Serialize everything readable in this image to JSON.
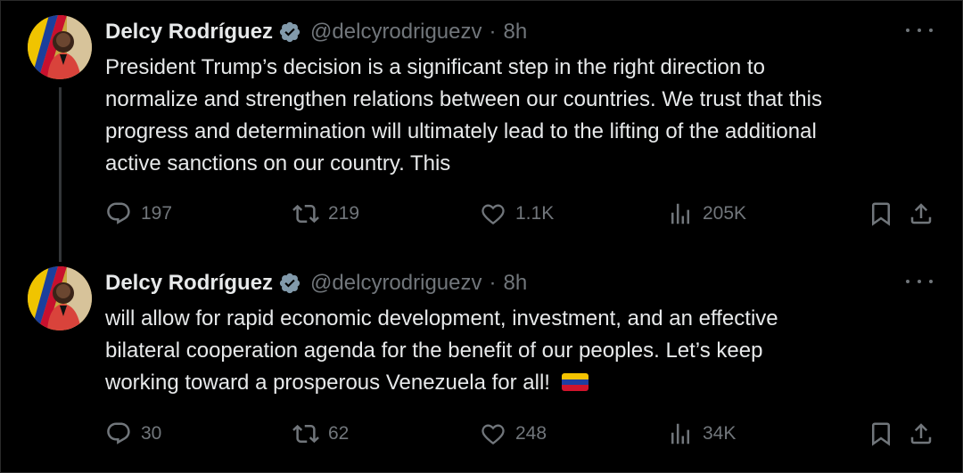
{
  "tweets": [
    {
      "name": "Delcy Rodríguez",
      "handle": "@delcyrodriguezv",
      "separator": "·",
      "time": "8h",
      "text": "President Trump’s decision is a significant step in the right direction to\nnormalize and strengthen relations between our countries. We trust that this\nprogress and determination will ultimately lead to the lifting of the additional\nactive sanctions on our country. This",
      "replies": "197",
      "reposts": "219",
      "likes": "1.1K",
      "views": "205K"
    },
    {
      "name": "Delcy Rodríguez",
      "handle": "@delcyrodriguezv",
      "separator": "·",
      "time": "8h",
      "text": "will allow for rapid economic development, investment, and an effective\nbilateral cooperation agenda for the benefit of our peoples. Let’s keep\nworking toward a prosperous Venezuela for all!",
      "emoji": "venezuela-flag",
      "replies": "30",
      "reposts": "62",
      "likes": "248",
      "views": "34K"
    }
  ],
  "colors": {
    "background": "#000000",
    "text": "#e7e9ea",
    "muted": "#71767b",
    "verified": "#829aab",
    "thread_line": "#333639"
  },
  "icons": [
    "reply-icon",
    "repost-icon",
    "like-icon",
    "views-icon",
    "bookmark-icon",
    "share-icon",
    "more-icon",
    "verified-icon"
  ]
}
